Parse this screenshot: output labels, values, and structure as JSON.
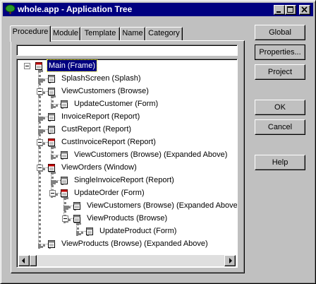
{
  "window": {
    "title": "whole.app - Application Tree",
    "controls": [
      "minimize-icon",
      "maximize-icon",
      "close-icon"
    ]
  },
  "tabs": [
    {
      "label": "Procedure",
      "active": true
    },
    {
      "label": "Module",
      "active": false
    },
    {
      "label": "Template",
      "active": false
    },
    {
      "label": "Name",
      "active": false
    },
    {
      "label": "Category",
      "active": false
    }
  ],
  "filter": {
    "value": ""
  },
  "buttons": {
    "global": "Global",
    "properties": "Properties...",
    "project": "Project",
    "ok": "OK",
    "cancel": "Cancel",
    "help": "Help"
  },
  "tree": [
    {
      "label": "Main (Frame)",
      "depth": 0,
      "icon": "frame-icon",
      "expanded": true,
      "selected": true
    },
    {
      "label": "SplashScreen (Splash)",
      "depth": 1,
      "icon": "procedure-icon"
    },
    {
      "label": "ViewCustomers (Browse)",
      "depth": 1,
      "icon": "procedure-icon",
      "expanded": true
    },
    {
      "label": "UpdateCustomer (Form)",
      "depth": 2,
      "icon": "procedure-icon"
    },
    {
      "label": "InvoiceReport (Report)",
      "depth": 1,
      "icon": "procedure-icon"
    },
    {
      "label": "CustReport (Report)",
      "depth": 1,
      "icon": "procedure-icon"
    },
    {
      "label": "CustInvoiceReport (Report)",
      "depth": 1,
      "icon": "frame-icon",
      "expanded": true
    },
    {
      "label": "ViewCustomers (Browse) (Expanded Above)",
      "depth": 2,
      "icon": "procedure-icon"
    },
    {
      "label": "ViewOrders (Window)",
      "depth": 1,
      "icon": "frame-icon",
      "expanded": true
    },
    {
      "label": "SingleInvoiceReport (Report)",
      "depth": 2,
      "icon": "procedure-icon"
    },
    {
      "label": "UpdateOrder (Form)",
      "depth": 2,
      "icon": "frame-icon",
      "expanded": true
    },
    {
      "label": "ViewCustomers (Browse) (Expanded Above)",
      "depth": 3,
      "icon": "procedure-icon"
    },
    {
      "label": "ViewProducts (Browse)",
      "depth": 3,
      "icon": "procedure-icon",
      "expanded": true
    },
    {
      "label": "UpdateProduct (Form)",
      "depth": 4,
      "icon": "procedure-icon"
    },
    {
      "label": "ViewProducts (Browse) (Expanded Above)",
      "depth": 1,
      "icon": "procedure-icon"
    }
  ],
  "scrollbar": {
    "left_arrow": "left-arrow-icon",
    "right_arrow": "right-arrow-icon"
  },
  "colors": {
    "titlebar": "#000080",
    "face": "#c0c0c0",
    "selection": "#000080",
    "frame_icon_red": "#c00000"
  }
}
